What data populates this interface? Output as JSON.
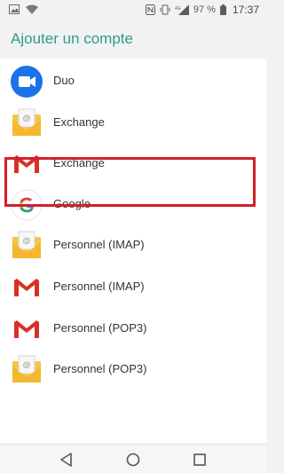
{
  "status_bar": {
    "battery_pct": "97 %",
    "time": "17:37",
    "network": "4G"
  },
  "header": {
    "title": "Ajouter un compte"
  },
  "accounts": [
    {
      "label": "Duo",
      "icon": "duo-icon"
    },
    {
      "label": "Exchange",
      "icon": "email-envelope-icon"
    },
    {
      "label": "Exchange",
      "icon": "gmail-icon"
    },
    {
      "label": "Google",
      "icon": "google-icon"
    },
    {
      "label": "Personnel (IMAP)",
      "icon": "email-envelope-icon"
    },
    {
      "label": "Personnel (IMAP)",
      "icon": "gmail-icon"
    },
    {
      "label": "Personnel (POP3)",
      "icon": "gmail-icon"
    },
    {
      "label": "Personnel (POP3)",
      "icon": "email-envelope-icon"
    }
  ],
  "colors": {
    "accent": "#2f9a8c",
    "highlight": "#d51f2a",
    "gmail_red": "#d93025",
    "envelope_yellow": "#f6c544",
    "duo_blue": "#1a73e8"
  },
  "nav_bar": {
    "buttons": [
      "back-icon",
      "home-icon",
      "recents-icon"
    ]
  }
}
